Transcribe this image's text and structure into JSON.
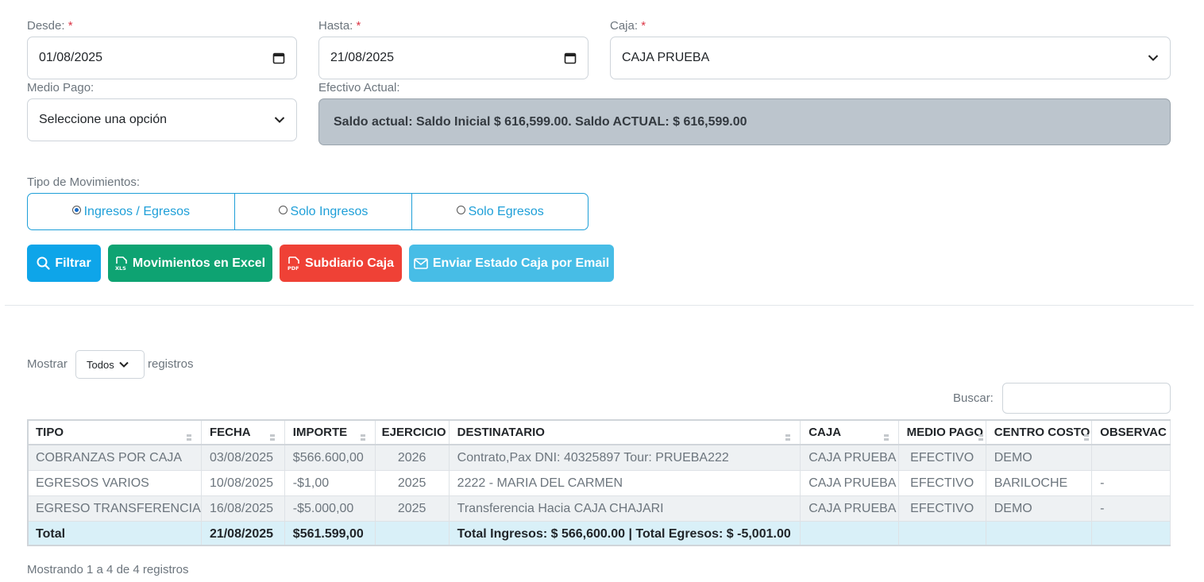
{
  "filters": {
    "desde_label": "Desde:",
    "desde_value": "01/08/2025",
    "hasta_label": "Hasta:",
    "hasta_value": "21/08/2025",
    "caja_label": "Caja:",
    "caja_value": "CAJA PRUEBA",
    "required_mark": "*",
    "medio_label": "Medio Pago:",
    "medio_value": "Seleccione una opción",
    "efectivo_label": "Efectivo Actual:",
    "efectivo_value": "Saldo actual: Saldo Inicial $ 616,599.00. Saldo ACTUAL: $ 616,599.00"
  },
  "tipo": {
    "label": "Tipo de Movimientos:",
    "options": [
      "Ingresos / Egresos",
      "Solo Ingresos",
      "Solo Egresos"
    ],
    "selected": 0
  },
  "buttons": {
    "filtrar": "Filtrar",
    "excel": "Movimientos en Excel",
    "subdiario": "Subdiario Caja",
    "email": "Enviar Estado Caja por Email"
  },
  "colors": {
    "filtrar": "#0ea5e9",
    "excel": "#0ea372",
    "subdiario": "#ef4136",
    "email": "#47bde6"
  },
  "length": {
    "prefix": "Mostrar",
    "value": "Todos",
    "suffix": "registros"
  },
  "search": {
    "label": "Buscar:",
    "value": ""
  },
  "table": {
    "columns": [
      "TIPO",
      "FECHA",
      "IMPORTE",
      "EJERCICIO",
      "DESTINATARIO",
      "CAJA",
      "MEDIO PAGO",
      "CENTRO COSTO",
      "OBSERVAC"
    ],
    "rows": [
      [
        "COBRANZAS POR CAJA",
        "03/08/2025",
        "$566.600,00",
        "2026",
        "Contrato,Pax DNI: 40325897 Tour: PRUEBA222",
        "CAJA PRUEBA",
        "EFECTIVO",
        "DEMO",
        ""
      ],
      [
        "EGRESOS VARIOS",
        "10/08/2025",
        "-$1,00",
        "2025",
        "2222 - MARIA DEL CARMEN",
        "CAJA PRUEBA",
        "EFECTIVO",
        "BARILOCHE",
        "-"
      ],
      [
        "EGRESO TRANSFERENCIA",
        "16/08/2025",
        "-$5.000,00",
        "2025",
        "Transferencia Hacia CAJA CHAJARI",
        "CAJA PRUEBA",
        "EFECTIVO",
        "DEMO",
        "-"
      ]
    ],
    "total": [
      "Total",
      "21/08/2025",
      "$561.599,00",
      "",
      "Total Ingresos: $ 566,600.00 | Total Egresos: $ -5,001.00",
      "",
      "",
      "",
      ""
    ]
  },
  "info": "Mostrando 1 a 4 de 4 registros"
}
